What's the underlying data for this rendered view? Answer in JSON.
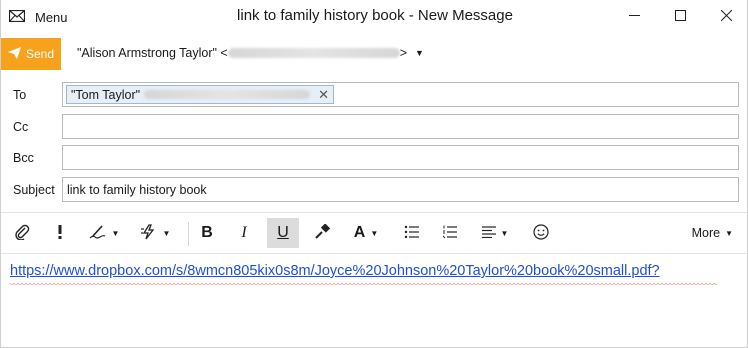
{
  "window": {
    "title": "link to family history book - New Message",
    "menu_label": "Menu"
  },
  "send": {
    "label": "Send",
    "accent_color": "#f7a21d"
  },
  "from": {
    "display": "\"Alison Armstrong Taylor\" <",
    "suffix": ">"
  },
  "fields": {
    "to_label": "To",
    "cc_label": "Cc",
    "bcc_label": "Bcc",
    "subject_label": "Subject",
    "to_chip": "\"Tom Taylor\"",
    "cc_value": "",
    "bcc_value": "",
    "subject_value": "link to family history book"
  },
  "toolbar": {
    "items": [
      "attach-icon",
      "importance-icon",
      "signature-icon",
      "quick-action-icon",
      "bold-icon",
      "italic-icon",
      "underline-icon",
      "format-painter-icon",
      "font-icon",
      "bullet-list-icon",
      "numbered-list-icon",
      "align-icon",
      "emoji-icon"
    ],
    "bold": "B",
    "italic": "I",
    "underline": "U",
    "font": "A",
    "more_label": "More"
  },
  "body": {
    "link_text": "https://www.dropbox.com/s/8wmcn805kix0s8m/Joyce%20Johnson%20Taylor%20book%20small.pdf?"
  }
}
